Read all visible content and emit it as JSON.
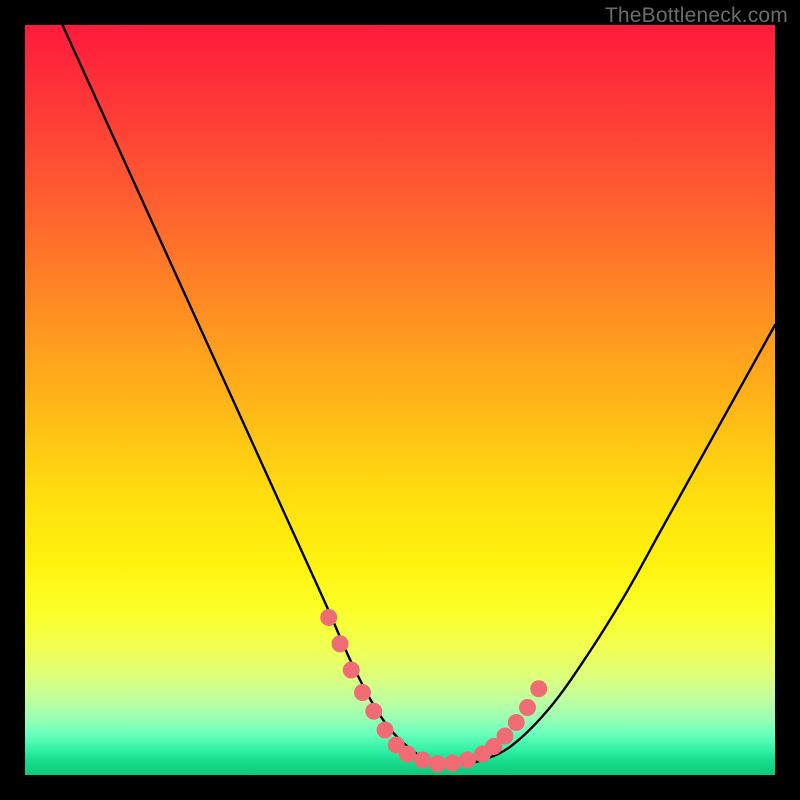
{
  "watermark": "TheBottleneck.com",
  "colors": {
    "frame": "#000000",
    "gradient_top": "#ff1a3d",
    "gradient_mid": "#ffe40e",
    "gradient_bottom": "#0acb78",
    "curve": "#000000",
    "marker": "#ef6c74"
  },
  "chart_data": {
    "type": "line",
    "title": "",
    "xlabel": "",
    "ylabel": "",
    "xlim": [
      0,
      100
    ],
    "ylim": [
      0,
      100
    ],
    "grid": false,
    "legend": false,
    "series": [
      {
        "name": "bottleneck-curve",
        "x": [
          5,
          10,
          15,
          20,
          25,
          30,
          35,
          40,
          44,
          48,
          52,
          55,
          58,
          61,
          65,
          70,
          75,
          80,
          85,
          90,
          95,
          100
        ],
        "y": [
          100,
          89,
          78,
          67,
          56,
          45,
          34,
          23,
          14,
          7,
          3,
          1.5,
          1.5,
          2,
          4,
          9,
          16,
          24,
          33,
          42,
          51,
          60
        ]
      }
    ],
    "markers": {
      "name": "highlight-dots",
      "x": [
        40.5,
        42.0,
        43.5,
        45.0,
        46.5,
        48.0,
        49.5,
        51.0,
        53.0,
        55.0,
        57.0,
        59.0,
        61.0,
        62.5,
        64.0,
        65.5,
        67.0,
        68.5
      ],
      "y": [
        21.0,
        17.5,
        14.0,
        11.0,
        8.5,
        6.0,
        4.0,
        2.8,
        2.0,
        1.5,
        1.6,
        2.0,
        2.8,
        3.8,
        5.2,
        7.0,
        9.0,
        11.5
      ]
    }
  }
}
